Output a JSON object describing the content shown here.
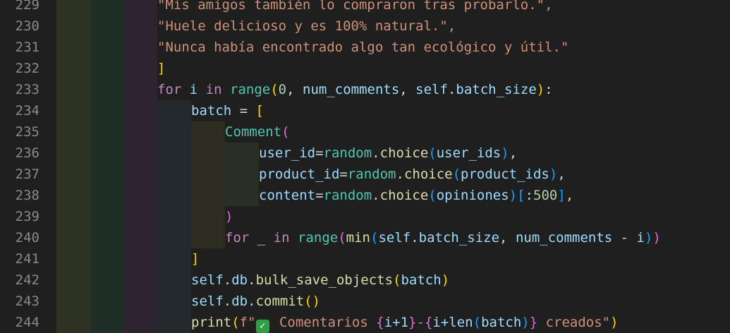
{
  "editor": {
    "colors": {
      "background": "#1f1f1f",
      "line_number": "#8a8a8a",
      "string": "#ce9178",
      "keyword": "#c586c0",
      "function": "#dcdcaa",
      "class": "#4ec9b0",
      "variable": "#9cdcfe",
      "number": "#b5cea8",
      "text": "#d4d4d4",
      "bracket_gold": "#ffd700",
      "bracket_pink": "#da70d6",
      "bracket_blue": "#179fff",
      "check_emoji": "#2ea043"
    },
    "indent_guides": [
      {
        "color": "#2d3222",
        "name": "indent-guide-1"
      },
      {
        "color": "#1f2e26",
        "name": "indent-guide-2"
      },
      {
        "color": "#2e2330",
        "name": "indent-guide-3"
      },
      {
        "color": "#24292d",
        "name": "indent-guide-4"
      },
      {
        "color": "#2d2d21",
        "name": "indent-guide-5"
      },
      {
        "color": "#2a2f26",
        "name": "indent-guide-6"
      }
    ],
    "lines": [
      {
        "num": "229",
        "indent": 0,
        "tokens": [
          {
            "t": "\"Mis amigos también lo compraron tras probarlo.\",",
            "c": "string"
          }
        ]
      },
      {
        "num": "230",
        "indent": 0,
        "tokens": [
          {
            "t": "\"Huele delicioso y es 100% natural.\",",
            "c": "string"
          }
        ]
      },
      {
        "num": "231",
        "indent": 0,
        "tokens": [
          {
            "t": "\"Nunca había encontrado algo tan ecológico y útil.\"",
            "c": "string"
          }
        ]
      },
      {
        "num": "232",
        "indent": 0,
        "tokens": [
          {
            "t": "]",
            "c": "bracket_gold"
          }
        ]
      },
      {
        "num": "233",
        "indent": 0,
        "tokens": [
          {
            "t": "for",
            "c": "keyword"
          },
          {
            "t": " i ",
            "c": "variable"
          },
          {
            "t": "in",
            "c": "keyword"
          },
          {
            "t": " ",
            "c": "text"
          },
          {
            "t": "range",
            "c": "class"
          },
          {
            "t": "(",
            "c": "bracket_gold"
          },
          {
            "t": "0",
            "c": "number"
          },
          {
            "t": ", ",
            "c": "text"
          },
          {
            "t": "num_comments",
            "c": "variable"
          },
          {
            "t": ", ",
            "c": "text"
          },
          {
            "t": "self",
            "c": "variable"
          },
          {
            "t": ".",
            "c": "text"
          },
          {
            "t": "batch_size",
            "c": "variable"
          },
          {
            "t": ")",
            "c": "bracket_gold"
          },
          {
            "t": ":",
            "c": "text"
          }
        ]
      },
      {
        "num": "234",
        "indent": 1,
        "tokens": [
          {
            "t": "batch",
            "c": "variable"
          },
          {
            "t": " = ",
            "c": "text"
          },
          {
            "t": "[",
            "c": "bracket_gold"
          }
        ]
      },
      {
        "num": "235",
        "indent": 2,
        "tokens": [
          {
            "t": "Comment",
            "c": "class"
          },
          {
            "t": "(",
            "c": "bracket_pink"
          }
        ]
      },
      {
        "num": "236",
        "indent": 3,
        "tokens": [
          {
            "t": "user_id",
            "c": "variable"
          },
          {
            "t": "=",
            "c": "text"
          },
          {
            "t": "random",
            "c": "class"
          },
          {
            "t": ".",
            "c": "text"
          },
          {
            "t": "choice",
            "c": "function"
          },
          {
            "t": "(",
            "c": "bracket_blue"
          },
          {
            "t": "user_ids",
            "c": "variable"
          },
          {
            "t": ")",
            "c": "bracket_blue"
          },
          {
            "t": ",",
            "c": "text"
          }
        ]
      },
      {
        "num": "237",
        "indent": 3,
        "tokens": [
          {
            "t": "product_id",
            "c": "variable"
          },
          {
            "t": "=",
            "c": "text"
          },
          {
            "t": "random",
            "c": "class"
          },
          {
            "t": ".",
            "c": "text"
          },
          {
            "t": "choice",
            "c": "function"
          },
          {
            "t": "(",
            "c": "bracket_blue"
          },
          {
            "t": "product_ids",
            "c": "variable"
          },
          {
            "t": ")",
            "c": "bracket_blue"
          },
          {
            "t": ",",
            "c": "text"
          }
        ]
      },
      {
        "num": "238",
        "indent": 3,
        "tokens": [
          {
            "t": "content",
            "c": "variable"
          },
          {
            "t": "=",
            "c": "text"
          },
          {
            "t": "random",
            "c": "class"
          },
          {
            "t": ".",
            "c": "text"
          },
          {
            "t": "choice",
            "c": "function"
          },
          {
            "t": "(",
            "c": "bracket_blue"
          },
          {
            "t": "opiniones",
            "c": "variable"
          },
          {
            "t": ")",
            "c": "bracket_blue"
          },
          {
            "t": "[",
            "c": "bracket_blue"
          },
          {
            "t": ":",
            "c": "text"
          },
          {
            "t": "500",
            "c": "number"
          },
          {
            "t": "]",
            "c": "bracket_blue"
          },
          {
            "t": ",",
            "c": "text"
          }
        ]
      },
      {
        "num": "239",
        "indent": 2,
        "tokens": [
          {
            "t": ")",
            "c": "bracket_pink"
          }
        ]
      },
      {
        "num": "240",
        "indent": 2,
        "tokens": [
          {
            "t": "for",
            "c": "keyword"
          },
          {
            "t": " _ ",
            "c": "variable"
          },
          {
            "t": "in",
            "c": "keyword"
          },
          {
            "t": " ",
            "c": "text"
          },
          {
            "t": "range",
            "c": "class"
          },
          {
            "t": "(",
            "c": "bracket_pink"
          },
          {
            "t": "min",
            "c": "function"
          },
          {
            "t": "(",
            "c": "bracket_blue"
          },
          {
            "t": "self",
            "c": "variable"
          },
          {
            "t": ".",
            "c": "text"
          },
          {
            "t": "batch_size",
            "c": "variable"
          },
          {
            "t": ", ",
            "c": "text"
          },
          {
            "t": "num_comments",
            "c": "variable"
          },
          {
            "t": " - ",
            "c": "text"
          },
          {
            "t": "i",
            "c": "variable"
          },
          {
            "t": ")",
            "c": "bracket_blue"
          },
          {
            "t": ")",
            "c": "bracket_pink"
          }
        ]
      },
      {
        "num": "241",
        "indent": 1,
        "tokens": [
          {
            "t": "]",
            "c": "bracket_gold"
          }
        ]
      },
      {
        "num": "242",
        "indent": 1,
        "tokens": [
          {
            "t": "self",
            "c": "variable"
          },
          {
            "t": ".",
            "c": "text"
          },
          {
            "t": "db",
            "c": "variable"
          },
          {
            "t": ".",
            "c": "text"
          },
          {
            "t": "bulk_save_objects",
            "c": "function"
          },
          {
            "t": "(",
            "c": "bracket_gold"
          },
          {
            "t": "batch",
            "c": "variable"
          },
          {
            "t": ")",
            "c": "bracket_gold"
          }
        ]
      },
      {
        "num": "243",
        "indent": 1,
        "tokens": [
          {
            "t": "self",
            "c": "variable"
          },
          {
            "t": ".",
            "c": "text"
          },
          {
            "t": "db",
            "c": "variable"
          },
          {
            "t": ".",
            "c": "text"
          },
          {
            "t": "commit",
            "c": "function"
          },
          {
            "t": "()",
            "c": "bracket_gold"
          }
        ]
      },
      {
        "num": "244",
        "indent": 1,
        "tokens": [
          {
            "t": "print",
            "c": "function"
          },
          {
            "t": "(",
            "c": "bracket_gold"
          },
          {
            "t": "f\"",
            "c": "string"
          },
          {
            "t": "✅",
            "c": "check_emoji"
          },
          {
            "t": " Comentarios ",
            "c": "string"
          },
          {
            "t": "{",
            "c": "bracket_pink"
          },
          {
            "t": "i+1",
            "c": "variable"
          },
          {
            "t": "}",
            "c": "bracket_pink"
          },
          {
            "t": "-",
            "c": "string"
          },
          {
            "t": "{",
            "c": "bracket_pink"
          },
          {
            "t": "i+len",
            "c": "variable"
          },
          {
            "t": "(",
            "c": "bracket_blue"
          },
          {
            "t": "batch",
            "c": "variable"
          },
          {
            "t": ")",
            "c": "bracket_blue"
          },
          {
            "t": "}",
            "c": "bracket_pink"
          },
          {
            "t": " creados\"",
            "c": "string"
          },
          {
            "t": ")",
            "c": "bracket_gold"
          }
        ]
      }
    ]
  }
}
